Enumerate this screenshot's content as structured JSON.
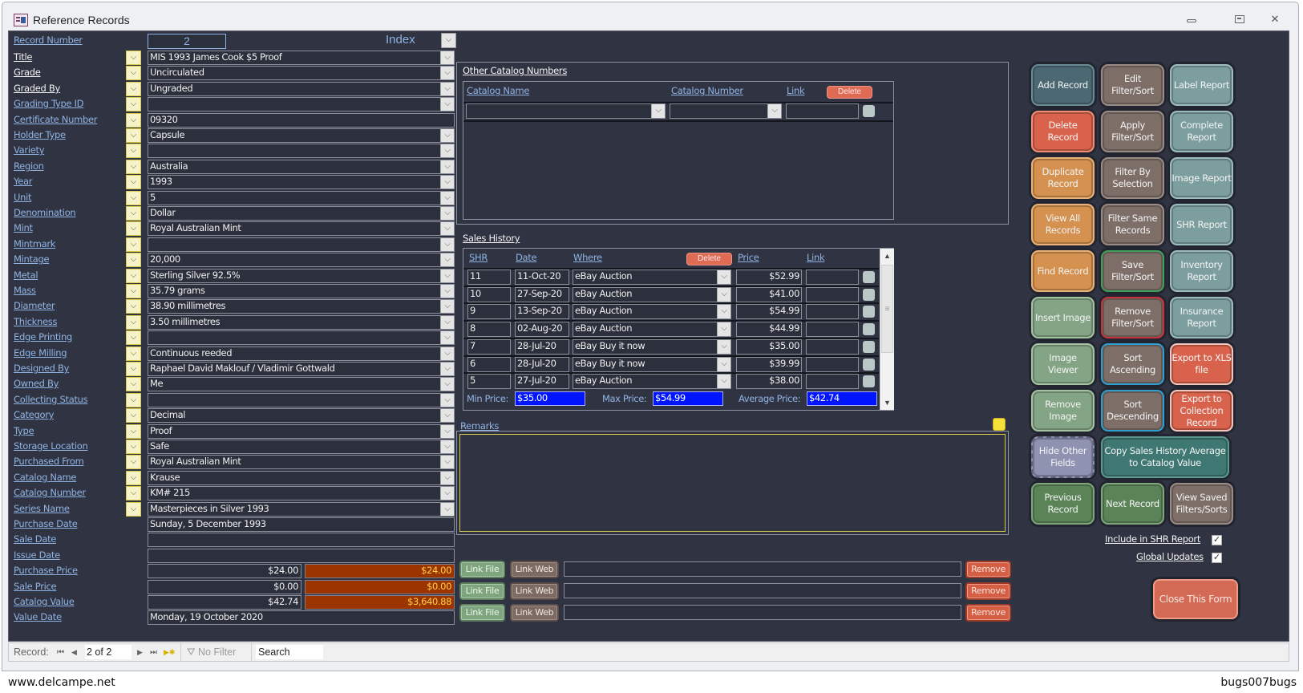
{
  "window": {
    "title": "Reference Records",
    "controls": [
      "minimize",
      "maximize",
      "close"
    ]
  },
  "record_number": {
    "label": "Record Number",
    "value": "2"
  },
  "index_label": "Index",
  "fields": [
    {
      "label": "Title",
      "value": "MIS 1993 James Cook $5 Proof",
      "combo": true,
      "dd": true,
      "white": true
    },
    {
      "label": "Grade",
      "value": "Uncirculated",
      "combo": true,
      "dd": true,
      "white": true
    },
    {
      "label": "Graded By",
      "value": "Ungraded",
      "combo": true,
      "dd": true,
      "white": true
    },
    {
      "label": "Grading Type ID",
      "value": "",
      "combo": true,
      "dd": true
    },
    {
      "label": "Certificate Number",
      "value": "09320",
      "combo": false,
      "dd": true
    },
    {
      "label": "Holder Type",
      "value": "Capsule",
      "combo": true,
      "dd": true
    },
    {
      "label": "Variety",
      "value": "",
      "combo": true,
      "dd": true
    },
    {
      "label": "Region",
      "value": "Australia",
      "combo": true,
      "dd": true
    },
    {
      "label": "Year",
      "value": "1993",
      "combo": true,
      "dd": true
    },
    {
      "label": "Unit",
      "value": "5",
      "combo": true,
      "dd": true
    },
    {
      "label": "Denomination",
      "value": "Dollar",
      "combo": true,
      "dd": true
    },
    {
      "label": "Mint",
      "value": "Royal Australian Mint",
      "combo": true,
      "dd": true
    },
    {
      "label": "Mintmark",
      "value": "",
      "combo": true,
      "dd": true
    },
    {
      "label": "Mintage",
      "value": "20,000",
      "combo": true,
      "dd": true
    },
    {
      "label": "Metal",
      "value": "Sterling Silver 92.5%",
      "combo": true,
      "dd": true
    },
    {
      "label": "Mass",
      "value": "35.79 grams",
      "combo": true,
      "dd": true
    },
    {
      "label": "Diameter",
      "value": "38.90 millimetres",
      "combo": true,
      "dd": true
    },
    {
      "label": "Thickness",
      "value": "3.50 millimetres",
      "combo": true,
      "dd": true
    },
    {
      "label": "Edge Printing",
      "value": "",
      "combo": true,
      "dd": true
    },
    {
      "label": "Edge Milling",
      "value": "Continuous reeded",
      "combo": true,
      "dd": true
    },
    {
      "label": "Designed By",
      "value": "Raphael David Maklouf / Vladimir Gottwald",
      "combo": true,
      "dd": true
    },
    {
      "label": "Owned By",
      "value": "Me",
      "combo": true,
      "dd": true
    },
    {
      "label": "Collecting Status",
      "value": "",
      "combo": true,
      "dd": true
    },
    {
      "label": "Category",
      "value": "Decimal",
      "combo": true,
      "dd": true
    },
    {
      "label": "Type",
      "value": "Proof",
      "combo": true,
      "dd": true
    },
    {
      "label": "Storage Location",
      "value": "Safe",
      "combo": true,
      "dd": true
    },
    {
      "label": "Purchased From",
      "value": "Royal Australian Mint",
      "combo": true,
      "dd": true
    },
    {
      "label": "Catalog Name",
      "value": "Krause",
      "combo": true,
      "dd": true
    },
    {
      "label": "Catalog Number",
      "value": "KM# 215",
      "combo": true,
      "dd": true
    },
    {
      "label": "Series Name",
      "value": "Masterpieces in Silver 1993",
      "combo": true,
      "dd": true
    },
    {
      "label": "Purchase Date",
      "value": "Sunday, 5 December 1993",
      "combo": false,
      "dd": false
    },
    {
      "label": "Sale Date",
      "value": "",
      "combo": false,
      "dd": false
    },
    {
      "label": "Issue Date",
      "value": "",
      "combo": false,
      "dd": false
    }
  ],
  "money_fields": [
    {
      "label": "Purchase Price",
      "value": "$24.00",
      "total": "$24.00"
    },
    {
      "label": "Sale Price",
      "value": "$0.00",
      "total": "$0.00"
    },
    {
      "label": "Catalog Value",
      "value": "$42.74",
      "total": "$3,640.88"
    }
  ],
  "value_date": {
    "label": "Value Date",
    "value": "Monday, 19 October 2020"
  },
  "other_catalog": {
    "title": "Other Catalog Numbers",
    "headers": {
      "name": "Catalog Name",
      "number": "Catalog Number",
      "link": "Link"
    },
    "delete_label": "Delete",
    "rows": [
      {
        "name": "",
        "number": "",
        "link": ""
      }
    ]
  },
  "sales_history": {
    "title": "Sales History",
    "headers": {
      "shr": "SHR",
      "date": "Date",
      "where": "Where",
      "price": "Price",
      "link": "Link"
    },
    "delete_label": "Delete",
    "rows": [
      {
        "shr": "11",
        "date": "11-Oct-20",
        "where": "eBay Auction",
        "price": "$52.99",
        "link": ""
      },
      {
        "shr": "10",
        "date": "27-Sep-20",
        "where": "eBay Auction",
        "price": "$41.00",
        "link": ""
      },
      {
        "shr": "9",
        "date": "13-Sep-20",
        "where": "eBay Auction",
        "price": "$54.99",
        "link": ""
      },
      {
        "shr": "8",
        "date": "02-Aug-20",
        "where": "eBay Auction",
        "price": "$44.99",
        "link": ""
      },
      {
        "shr": "7",
        "date": "28-Jul-20",
        "where": "eBay Buy it now",
        "price": "$35.00",
        "link": ""
      },
      {
        "shr": "6",
        "date": "28-Jul-20",
        "where": "eBay Buy it now",
        "price": "$39.99",
        "link": ""
      },
      {
        "shr": "5",
        "date": "27-Jul-20",
        "where": "eBay Auction",
        "price": "$38.00",
        "link": ""
      }
    ],
    "summary": {
      "min_label": "Min Price:",
      "min": "$35.00",
      "max_label": "Max Price:",
      "max": "$54.99",
      "avg_label": "Average Price:",
      "avg": "$42.74"
    }
  },
  "remarks": {
    "label": "Remarks",
    "value": ""
  },
  "links": {
    "link_file_label": "Link File",
    "link_web_label": "Link Web",
    "remove_label": "Remove",
    "rows": [
      "",
      "",
      ""
    ]
  },
  "buttons": [
    {
      "label": "Add Record",
      "style": "b-slate"
    },
    {
      "label": "Edit Filter/Sort",
      "style": "b-brown"
    },
    {
      "label": "Label Report",
      "style": "b-teal"
    },
    {
      "label": "Delete Record",
      "style": "b-red"
    },
    {
      "label": "Apply Filter/Sort",
      "style": "b-brown"
    },
    {
      "label": "Complete Report",
      "style": "b-teal"
    },
    {
      "label": "Duplicate Record",
      "style": "b-orange"
    },
    {
      "label": "Filter By Selection",
      "style": "b-brown"
    },
    {
      "label": "Image Report",
      "style": "b-teal"
    },
    {
      "label": "View All Records",
      "style": "b-orange"
    },
    {
      "label": "Filter  Same Records",
      "style": "b-brown"
    },
    {
      "label": "SHR Report",
      "style": "b-teal"
    },
    {
      "label": "Find Record",
      "style": "b-orange"
    },
    {
      "label": "Save Filter/Sort",
      "style": "b-brown ring-green"
    },
    {
      "label": "Inventory Report",
      "style": "b-teal"
    },
    {
      "label": "Insert Image",
      "style": "b-sage"
    },
    {
      "label": "Remove Filter/Sort",
      "style": "b-brown ring-red"
    },
    {
      "label": "Insurance Report",
      "style": "b-teal"
    },
    {
      "label": "Image Viewer",
      "style": "b-sage"
    },
    {
      "label": "Sort Ascending",
      "style": "b-brown ring-blue"
    },
    {
      "label": "Export to XLS file",
      "style": "b-red ring-pink"
    },
    {
      "label": "Remove Image",
      "style": "b-sage"
    },
    {
      "label": "Sort Descending",
      "style": "b-brown ring-blue"
    },
    {
      "label": "Export to Collection Record",
      "style": "b-red ring-pink"
    }
  ],
  "hide_other_fields": "Hide Other Fields",
  "copy_sales_avg": "Copy Sales History Average to Catalog Value",
  "previous_record": "Previous Record",
  "next_record": "Next Record",
  "view_saved": "View Saved Filters/Sorts",
  "include_shr": {
    "label": "Include in SHR Report",
    "checked": true
  },
  "global_updates": {
    "label": "Global Updates",
    "checked": true
  },
  "close_form": "Close This Form",
  "navbar": {
    "record_label": "Record:",
    "position": "2 of 2",
    "filter_label": "No Filter",
    "search_placeholder": "Search"
  },
  "watermarks": {
    "left": "www.delcampe.net",
    "right": "bugs007bugs"
  }
}
